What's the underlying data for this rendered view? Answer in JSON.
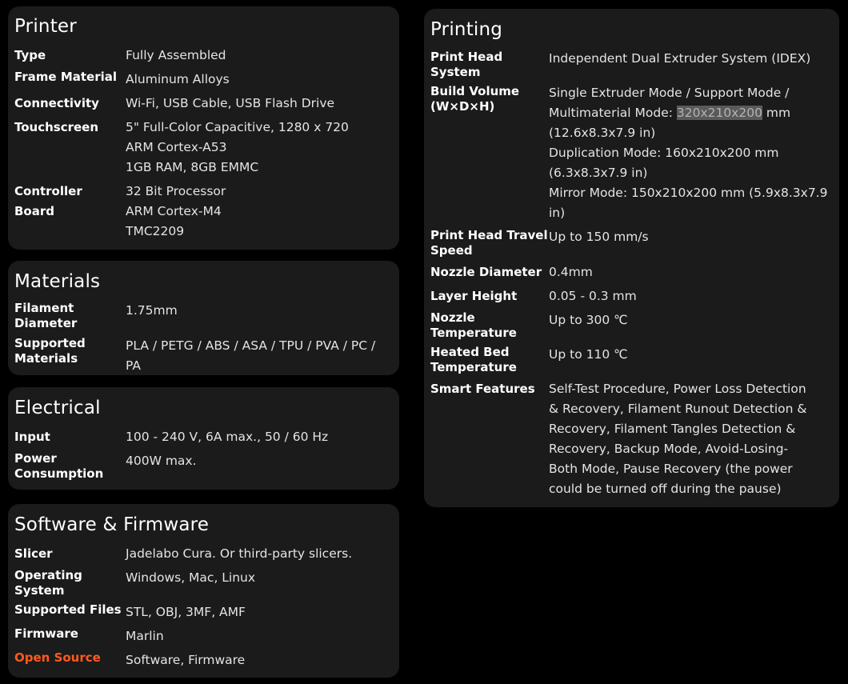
{
  "colors": {
    "background": "#000000",
    "card": "#1b1b1b",
    "accent": "#ff5a1f",
    "highlight": "#5a5a5a"
  },
  "printer": {
    "title": "Printer",
    "type_label": "Type",
    "type_value": "Fully Assembled",
    "frame_label": "Frame Material",
    "frame_value": "Aluminum Alloys",
    "connectivity_label": "Connectivity",
    "connectivity_value": "Wi-Fi, USB Cable, USB Flash Drive",
    "touchscreen_label": "Touchscreen",
    "touchscreen_value": [
      "5\" Full-Color Capacitive, 1280 x 720",
      "ARM Cortex-A53",
      "1GB RAM, 8GB EMMC"
    ],
    "controller_label": [
      "Controller",
      "Board"
    ],
    "controller_value": [
      "32 Bit Processor",
      "ARM Cortex-M4",
      "TMC2209"
    ]
  },
  "materials": {
    "title": "Materials",
    "filament_label": [
      "Filament",
      "Diameter"
    ],
    "filament_value": "1.75mm",
    "supported_label": [
      "Supported",
      "Materials"
    ],
    "supported_value": [
      "PLA / PETG / ABS / ASA / TPU / PVA / PC /",
      "PA"
    ]
  },
  "electrical": {
    "title": "Electrical",
    "input_label": "Input",
    "input_value": "100 - 240 V, 6A max., 50 / 60 Hz",
    "power_label": [
      "Power",
      "Consumption"
    ],
    "power_value": "400W max."
  },
  "software": {
    "title": "Software & Firmware",
    "slicer_label": "Slicer",
    "slicer_value": "Jadelabo Cura. Or third-party slicers.",
    "os_label": [
      "Operating",
      "System"
    ],
    "os_value": "Windows, Mac, Linux",
    "files_label": "Supported Files",
    "files_value": "STL, OBJ, 3MF, AMF",
    "firmware_label": "Firmware",
    "firmware_value": "Marlin",
    "opensource_label": "Open Source",
    "opensource_value": "Software, Firmware"
  },
  "printing": {
    "title": "Printing",
    "head_label": [
      "Print Head",
      "System"
    ],
    "head_value": "Independent Dual Extruder System (IDEX)",
    "volume_label": [
      "Build Volume",
      "(W×D×H)"
    ],
    "volume_line1": "Single Extruder Mode / Support Mode /",
    "volume_line2_pre": "Multimaterial Mode: ",
    "volume_line2_hl": "320x210x200",
    "volume_line2_post": " mm",
    "volume_rest": [
      "(12.6x8.3x7.9 in)",
      "Duplication Mode: 160x210x200 mm",
      "(6.3x8.3x7.9 in)",
      "Mirror Mode: 150x210x200 mm (5.9x8.3x7.9",
      "in)"
    ],
    "travel_label": [
      "Print Head Travel",
      "Speed"
    ],
    "travel_value": "Up to 150 mm/s",
    "nozzle_label": "Nozzle Diameter",
    "nozzle_value": "0.4mm",
    "layer_label": "Layer Height",
    "layer_value": "0.05 - 0.3 mm",
    "nozzle_temp_label": [
      "Nozzle",
      "Temperature"
    ],
    "nozzle_temp_value": "Up to 300 ℃",
    "bed_temp_label": [
      "Heated Bed",
      "Temperature"
    ],
    "bed_temp_value": "Up to 110 ℃",
    "smart_label": "Smart Features",
    "smart_value": [
      "Self-Test Procedure, Power Loss Detection",
      "& Recovery, Filament Runout Detection &",
      "Recovery, Filament Tangles Detection &",
      "Recovery, Backup Mode, Avoid-Losing-",
      "Both Mode, Pause Recovery (the power",
      "could be turned off during the pause)"
    ]
  }
}
